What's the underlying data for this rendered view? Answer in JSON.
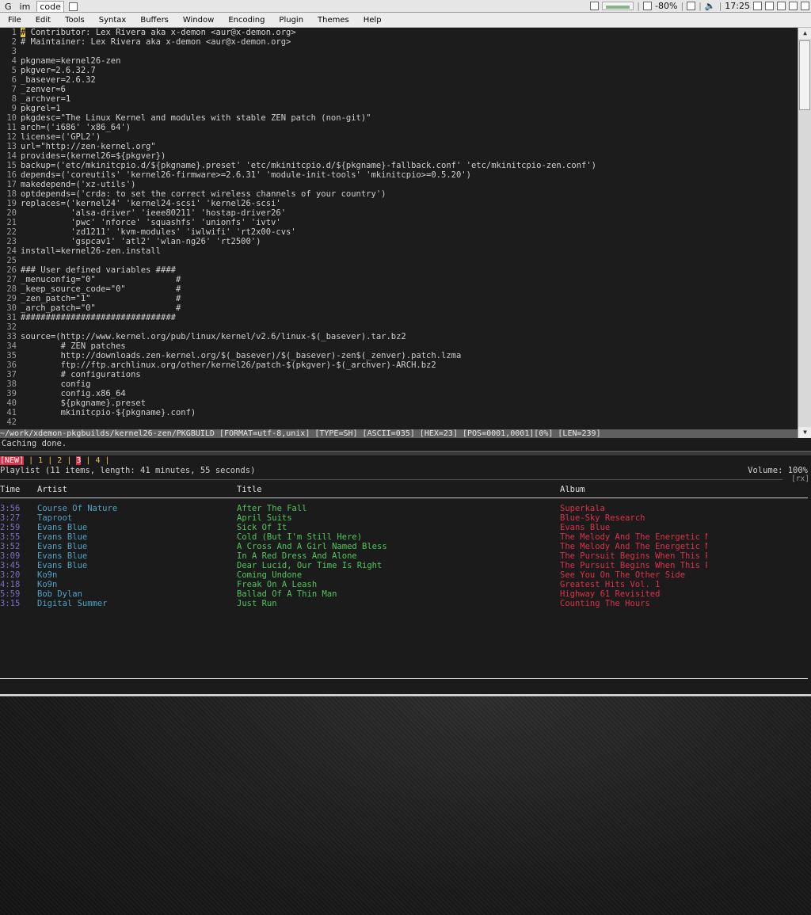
{
  "panel": {
    "workspaces": [
      "G",
      "im",
      "code"
    ],
    "battery": "-80%",
    "clock": "17:25"
  },
  "menubar": [
    "File",
    "Edit",
    "Tools",
    "Syntax",
    "Buffers",
    "Window",
    "Encoding",
    "Plugin",
    "Themes",
    "Help"
  ],
  "editor": {
    "lines": [
      "# Contributor: Lex Rivera aka x-demon <aur@x-demon.org>",
      "# Maintainer: Lex Rivera aka x-demon <aur@x-demon.org>",
      "",
      "pkgname=kernel26-zen",
      "pkgver=2.6.32.7",
      "_basever=2.6.32",
      "_zenver=6",
      "_archver=1",
      "pkgrel=1",
      "pkgdesc=\"The Linux Kernel and modules with stable ZEN patch (non-git)\"",
      "arch=('i686' 'x86_64')",
      "license=('GPL2')",
      "url=\"http://zen-kernel.org\"",
      "provides=(kernel26=${pkgver})",
      "backup=('etc/mkinitcpio.d/${pkgname}.preset' 'etc/mkinitcpio.d/${pkgname}-fallback.conf' 'etc/mkinitcpio-zen.conf')",
      "depends=('coreutils' 'kernel26-firmware>=2.6.31' 'module-init-tools' 'mkinitcpio>=0.5.20')",
      "makedepend=('xz-utils')",
      "optdepends=('crda: to set the correct wireless channels of your country')",
      "replaces=('kernel24' 'kernel24-scsi' 'kernel26-scsi'",
      "          'alsa-driver' 'ieee80211' 'hostap-driver26'",
      "          'pwc' 'nforce' 'squashfs' 'unionfs' 'ivtv'",
      "          'zd1211' 'kvm-modules' 'iwlwifi' 'rt2x00-cvs'",
      "          'gspcav1' 'atl2' 'wlan-ng26' 'rt2500')",
      "install=kernel26-zen.install",
      "",
      "### User defined variables ####",
      "_menuconfig=\"0\"                #",
      "_keep_source_code=\"0\"          #",
      "_zen_patch=\"1\"                 #",
      "_arch_patch=\"0\"                #",
      "###############################",
      "",
      "source=(http://www.kernel.org/pub/linux/kernel/v2.6/linux-$(_basever).tar.bz2",
      "        # ZEN patches",
      "        http://downloads.zen-kernel.org/$(_basever)/$(_basever)-zen$(_zenver).patch.lzma",
      "        ftp://ftp.archlinux.org/other/kernel26/patch-$(pkgver)-$(_archver)-ARCH.bz2",
      "        # configurations",
      "        config",
      "        config.x86_64",
      "        ${pkgname}.preset",
      "        mkinitcpio-${pkgname}.conf)",
      ""
    ],
    "status": "~/work/xdemon-pkgbuilds/kernel26-zen/PKGBUILD [FORMAT=utf-8,unix] [TYPE=SH] [ASCII=035] [HEX=23] [POS=0001,0001][0%] [LEN=239]",
    "message": "Caching done."
  },
  "player": {
    "tabs": [
      "[NEW]",
      "1",
      "2",
      "3",
      "4"
    ],
    "playlist_info": "Playlist (11 items, length: 41 minutes, 55 seconds)",
    "volume": "Volume: 100%",
    "mode": "[rx]",
    "columns": [
      "Time",
      "Artist",
      "Title",
      "Album"
    ],
    "rows": [
      {
        "time": "3:56",
        "artist": "Course Of Nature",
        "title": "After The Fall",
        "album": "Superkala"
      },
      {
        "time": "3:27",
        "artist": "Taproot",
        "title": "April Suits",
        "album": "Blue-Sky Research"
      },
      {
        "time": "2:59",
        "artist": "Evans Blue",
        "title": "Sick Of It",
        "album": "Evans Blue"
      },
      {
        "time": "3:55",
        "artist": "Evans Blue",
        "title": "Cold (But I'm Still Here)",
        "album": "The Melody And The Energetic N"
      },
      {
        "time": "3:52",
        "artist": "Evans Blue",
        "title": "A Cross And A Girl Named Bless",
        "album": "The Melody And The Energetic N"
      },
      {
        "time": "3:09",
        "artist": "Evans Blue",
        "title": "In A Red Dress And Alone",
        "album": "The Pursuit Begins When This P"
      },
      {
        "time": "3:45",
        "artist": "Evans Blue",
        "title": "Dear Lucid, Our Time Is Right",
        "album": "The Pursuit Begins When This P"
      },
      {
        "time": "3:20",
        "artist": "Ko9n",
        "title": "Coming Undone",
        "album": "See You On The Other Side"
      },
      {
        "time": "4:18",
        "artist": "Ko9n",
        "title": "Freak On A Leash",
        "album": "Greatest Hits Vol. 1"
      },
      {
        "time": "5:59",
        "artist": "Bob Dylan",
        "title": "Ballad Of A Thin Man",
        "album": "Highway 61 Revisited"
      },
      {
        "time": "3:15",
        "artist": "Digital Summer",
        "title": "Just Run",
        "album": "Counting The Hours"
      }
    ]
  }
}
